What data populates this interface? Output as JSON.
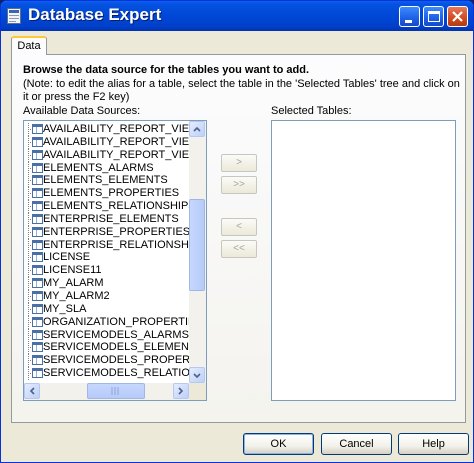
{
  "window": {
    "title": "Database Expert",
    "icon": "database-expert-icon"
  },
  "tabs": [
    {
      "label": "Data",
      "selected": true
    }
  ],
  "instructions": {
    "heading": "Browse the data source for the tables you want to add.",
    "note": "(Note: to edit the alias for a table, select the table in the 'Selected Tables' tree and click on it or press the F2 key)"
  },
  "available": {
    "label": "Available Data Sources:",
    "items": [
      "AVAILABILITY_REPORT_VIEW_IN",
      "AVAILABILITY_REPORT_VIEW_IN",
      "AVAILABILITY_REPORT_VIEW_S",
      "ELEMENTS_ALARMS",
      "ELEMENTS_ELEMENTS",
      "ELEMENTS_PROPERTIES",
      "ELEMENTS_RELATIONSHIPS",
      "ENTERPRISE_ELEMENTS",
      "ENTERPRISE_PROPERTIES",
      "ENTERPRISE_RELATIONSHIPS",
      "LICENSE",
      "LICENSE11",
      "MY_ALARM",
      "MY_ALARM2",
      "MY_SLA",
      "ORGANIZATION_PROPERTIES",
      "SERVICEMODELS_ALARMS",
      "SERVICEMODELS_ELEMENTS",
      "SERVICEMODELS_PROPERTIES",
      "SERVICEMODELS_RELATIONSHI"
    ]
  },
  "selected": {
    "label": "Selected Tables:",
    "items": []
  },
  "move_buttons": {
    "add": ">",
    "add_all": ">>",
    "remove": "<",
    "remove_all": "<<"
  },
  "footer": {
    "ok": "OK",
    "cancel": "Cancel",
    "help": "Help"
  },
  "colors": {
    "titlebar": "#0047d6",
    "window_bg": "#ece9d8",
    "list_border": "#7f9db9"
  }
}
